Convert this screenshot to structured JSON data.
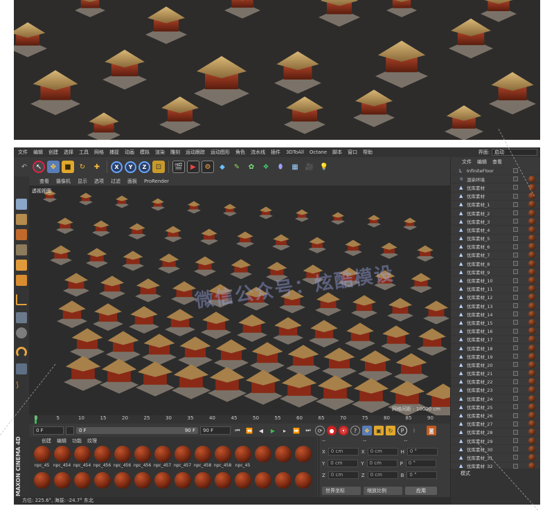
{
  "menubar": {
    "items": [
      "文件",
      "编辑",
      "创建",
      "选择",
      "工具",
      "网格",
      "捕捉",
      "动画",
      "模拟",
      "渲染",
      "雕刻",
      "运动跟踪",
      "运动图形",
      "角色",
      "流水线",
      "插件",
      "3DToAll",
      "Octane",
      "脚本",
      "窗口",
      "帮助"
    ],
    "layout_label": "界面:",
    "layout_value": "启动"
  },
  "viewport": {
    "menu": [
      "查看",
      "摄像机",
      "显示",
      "选项",
      "过滤",
      "面板",
      "ProRender"
    ],
    "label": "透视视图",
    "grid_spacing": "网格间距 : 10000 cm",
    "watermark": "微信公众号：炫酷模设"
  },
  "timeline": {
    "ticks": [
      "0",
      "5",
      "10",
      "15",
      "20",
      "25",
      "30",
      "35",
      "40",
      "45",
      "50",
      "55",
      "60",
      "65",
      "70",
      "75",
      "80",
      "85",
      "90"
    ],
    "start_frame": "0 F",
    "current_frame": "0 F",
    "slider_end": "90 F",
    "end_frame": "90 F"
  },
  "material_panel": {
    "menu": [
      "创建",
      "编辑",
      "功能",
      "纹理"
    ],
    "materials": [
      "npc_45",
      "npc_454",
      "npc_454",
      "npc_456",
      "npc_456",
      "npc_456",
      "npc_457",
      "npc_457",
      "npc_458",
      "npc_458",
      "npc_45",
      "",
      "",
      "",
      "",
      "",
      "",
      "",
      "",
      "",
      "",
      "",
      "",
      "",
      "",
      "",
      "",
      ""
    ]
  },
  "coords": {
    "header": [
      "--",
      "--",
      "--"
    ],
    "rows": [
      {
        "axis": "X",
        "pos": "0 cm",
        "axis2": "X",
        "size": "0 cm",
        "rot_axis": "H",
        "rot": "0 °"
      },
      {
        "axis": "Y",
        "pos": "0 cm",
        "axis2": "Y",
        "size": "0 cm",
        "rot_axis": "P",
        "rot": "0 °"
      },
      {
        "axis": "Z",
        "pos": "0 cm",
        "axis2": "Z",
        "size": "0 cm",
        "rot_axis": "B",
        "rot": "0 °"
      }
    ],
    "mode1": "世界坐标",
    "mode2": "缩放比例",
    "apply": "应用"
  },
  "status": {
    "text": "方位: 225.6°, 海拔: -24.7° 东北"
  },
  "brand": "MAXON CINEMA 4D",
  "objects": {
    "menu": [
      "文件",
      "编辑",
      "查看"
    ],
    "items": [
      "InfiniteFloor",
      "渲染环境",
      "优库素材",
      "优库素材",
      "优库素材_1",
      "优库素材_2",
      "优库素材_3",
      "优库素材_4",
      "优库素材_5",
      "优库素材_6",
      "优库素材_7",
      "优库素材_8",
      "优库素材_9",
      "优库素材_10",
      "优库素材_11",
      "优库素材_12",
      "优库素材_13",
      "优库素材_14",
      "优库素材_15",
      "优库素材_16",
      "优库素材_17",
      "优库素材_18",
      "优库素材_19",
      "优库素材_20",
      "优库素材_21",
      "优库素材_22",
      "优库素材_23",
      "优库素材_24",
      "优库素材_25",
      "优库素材_26",
      "优库素材_27",
      "优库素材_28",
      "优库素材_29",
      "优库素材_30",
      "优库素材_31",
      "优库素材_32"
    ],
    "bottom_label": "模式"
  },
  "colors": {
    "accent_blue": "#6aa7ff",
    "app_bg": "#3a3a3a",
    "hero_bg": "#2d2c2b"
  }
}
